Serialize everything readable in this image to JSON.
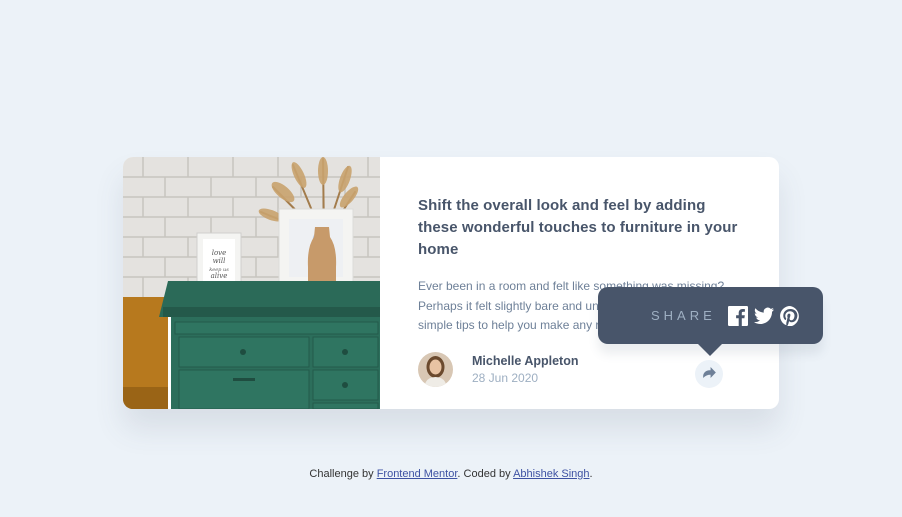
{
  "article": {
    "title": "Shift the overall look and feel by adding these wonderful touches to furniture in your home",
    "excerpt": "Ever been in a room and felt like something was missing? Perhaps it felt slightly bare and uninviting. I’ve got some simple tips to help you make any room feel complete."
  },
  "author": {
    "name": "Michelle Appleton",
    "date": "28 Jun 2020"
  },
  "share": {
    "label": "SHARE",
    "icons": [
      "facebook-icon",
      "twitter-icon",
      "pinterest-icon"
    ],
    "button_icon": "share-icon"
  },
  "footer": {
    "prefix": "Challenge by ",
    "challenge_link": "Frontend Mentor",
    "middle": ". Coded by ",
    "author_link": "Abhishek Singh",
    "suffix": "."
  },
  "colors": {
    "background": "#ecf2f8",
    "card": "#ffffff",
    "tooltip": "#48556a",
    "title": "#48556a",
    "text": "#6e8098",
    "muted": "#9eafc2"
  }
}
